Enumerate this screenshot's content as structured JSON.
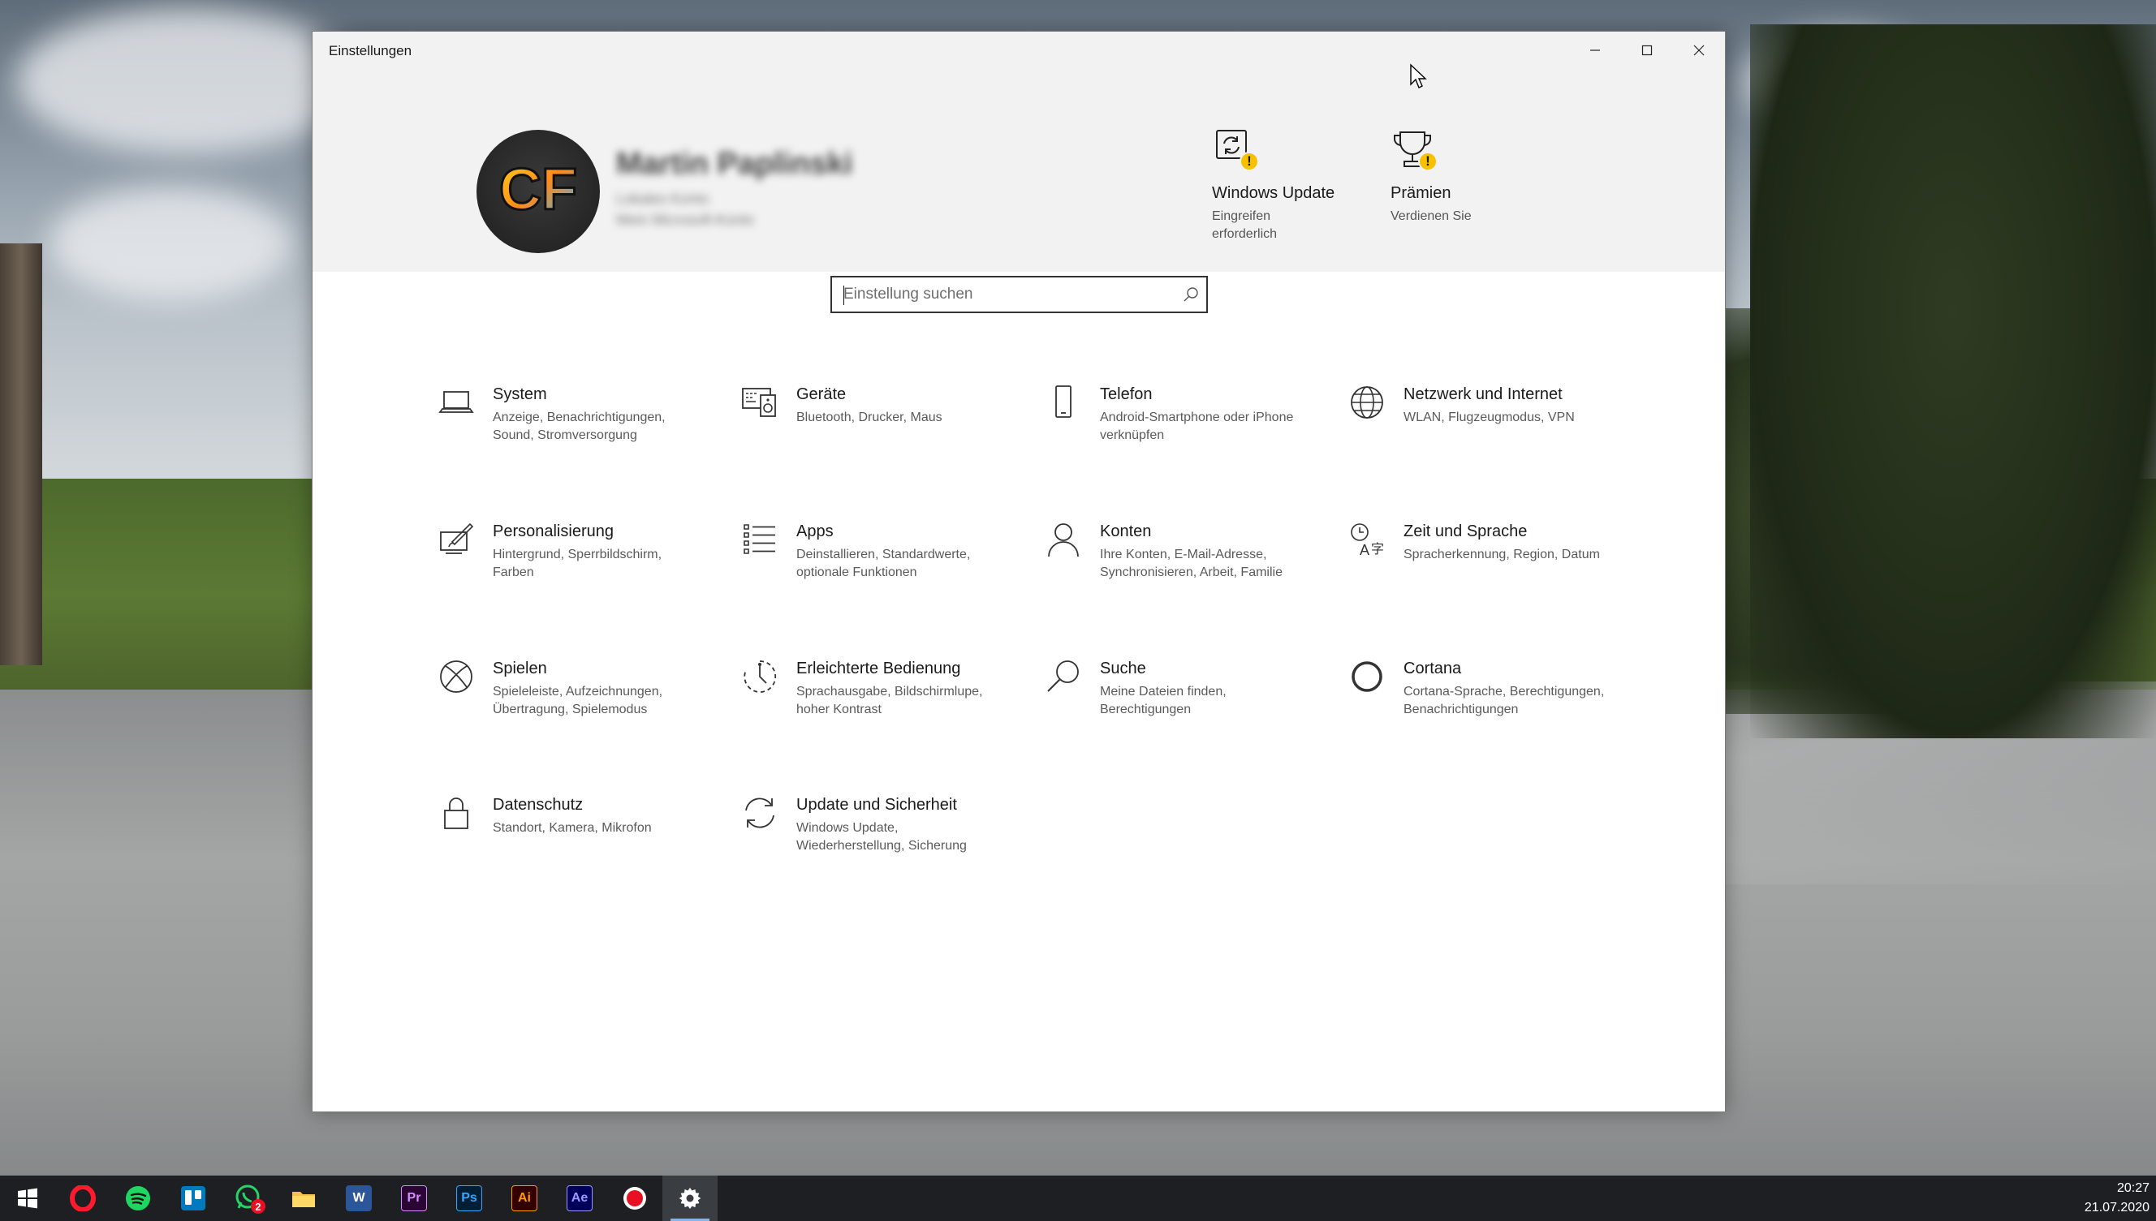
{
  "window": {
    "title": "Einstellungen"
  },
  "profile": {
    "avatar_text": "CF",
    "name": "Martin Paplinski",
    "line1": "Lokales Konto",
    "line2": "Mein Microsoft-Konto"
  },
  "quick": [
    {
      "title": "Windows Update",
      "sub": "Eingreifen erforderlich",
      "icon": "windows-update-icon",
      "badge": "!"
    },
    {
      "title": "Prämien",
      "sub": "Verdienen Sie",
      "icon": "trophy-icon",
      "badge": "!"
    }
  ],
  "search": {
    "placeholder": "Einstellung suchen"
  },
  "categories": [
    {
      "title": "System",
      "sub": "Anzeige, Benachrichtigungen, Sound, Stromversorgung",
      "icon": "laptop-icon"
    },
    {
      "title": "Geräte",
      "sub": "Bluetooth, Drucker, Maus",
      "icon": "keyboard-speaker-icon"
    },
    {
      "title": "Telefon",
      "sub": "Android-Smartphone oder iPhone verknüpfen",
      "icon": "phone-icon"
    },
    {
      "title": "Netzwerk und Internet",
      "sub": "WLAN, Flugzeugmodus, VPN",
      "icon": "globe-icon"
    },
    {
      "title": "Personalisierung",
      "sub": "Hintergrund, Sperrbildschirm, Farben",
      "icon": "paint-icon"
    },
    {
      "title": "Apps",
      "sub": "Deinstallieren, Standardwerte, optionale Funktionen",
      "icon": "apps-list-icon"
    },
    {
      "title": "Konten",
      "sub": "Ihre Konten, E-Mail-Adresse, Synchronisieren, Arbeit, Familie",
      "icon": "person-icon"
    },
    {
      "title": "Zeit und Sprache",
      "sub": "Spracherkennung, Region, Datum",
      "icon": "time-language-icon"
    },
    {
      "title": "Spielen",
      "sub": "Spieleleiste, Aufzeichnungen, Übertragung, Spielemodus",
      "icon": "xbox-icon"
    },
    {
      "title": "Erleichterte Bedienung",
      "sub": "Sprachausgabe, Bildschirmlupe, hoher Kontrast",
      "icon": "accessibility-icon"
    },
    {
      "title": "Suche",
      "sub": "Meine Dateien finden, Berechtigungen",
      "icon": "search-icon"
    },
    {
      "title": "Cortana",
      "sub": "Cortana-Sprache, Berechtigungen, Benachrichtigungen",
      "icon": "cortana-icon"
    },
    {
      "title": "Datenschutz",
      "sub": "Standort, Kamera, Mikrofon",
      "icon": "lock-icon"
    },
    {
      "title": "Update und Sicherheit",
      "sub": "Windows Update, Wiederherstellung, Sicherung",
      "icon": "sync-icon"
    }
  ],
  "taskbar": {
    "apps": [
      {
        "name": "windows-start-icon",
        "label": ""
      },
      {
        "name": "opera-icon",
        "label": ""
      },
      {
        "name": "spotify-icon",
        "label": ""
      },
      {
        "name": "trello-icon",
        "label": ""
      },
      {
        "name": "whatsapp-icon",
        "label": "2"
      },
      {
        "name": "file-explorer-icon",
        "label": ""
      },
      {
        "name": "word-icon",
        "label": "W"
      },
      {
        "name": "premiere-icon",
        "label": "Pr"
      },
      {
        "name": "photoshop-icon",
        "label": "Ps"
      },
      {
        "name": "illustrator-icon",
        "label": "Ai"
      },
      {
        "name": "after-effects-icon",
        "label": "Ae"
      },
      {
        "name": "record-icon",
        "label": ""
      },
      {
        "name": "settings-gear-icon",
        "label": ""
      }
    ],
    "time": "20:27",
    "date": "21.07.2020"
  },
  "colors": {
    "badge": "#f7c100",
    "header_bg": "#f2f2f2",
    "taskbar_bg": "#1d1f22"
  }
}
